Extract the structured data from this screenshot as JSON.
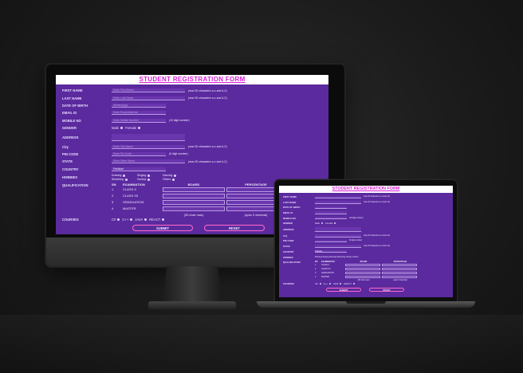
{
  "form": {
    "title": "STUDENT REGISTRATION FORM",
    "fields": [
      {
        "label": "FIRST NAME",
        "placeholder": "Enter First Name",
        "hint": "(max 30 characters a-z and A-Z)"
      },
      {
        "label": "LAST NAME",
        "placeholder": "Enter Last Name",
        "hint": "(max 30 characters a-z and A-Z)"
      },
      {
        "label": "DATE OF BIRTH",
        "placeholder": "dd/mm/yyyy",
        "hint": ""
      },
      {
        "label": "EMAIL ID",
        "placeholder": "Enter Email Address",
        "hint": ""
      },
      {
        "label": "MOBILE NO",
        "placeholder": "Enter Mobile Number",
        "hint": "(10 digit number)"
      }
    ],
    "gender": {
      "label": "GENDER",
      "options": [
        "Male",
        "Female"
      ]
    },
    "address": {
      "label": "ADDRESS"
    },
    "city": {
      "label": "City",
      "placeholder": "Enter City Name",
      "hint": "(max 30 characters a-z and A-Z)"
    },
    "pin": {
      "label": "PIN CODE",
      "placeholder": "Enter Pin Code",
      "hint": "(6 digit number)"
    },
    "state": {
      "label": "STATE",
      "placeholder": "Enter State Name",
      "hint": "(max 30 characters a-z and A-Z)"
    },
    "country": {
      "label": "COUNTRY",
      "value": "Pakistan"
    },
    "hobbies": {
      "label": "HOBBIES",
      "items": [
        "Drawing",
        "Singing",
        "Dancing",
        "Sketching",
        "Hockey",
        "Others"
      ]
    },
    "qualification": {
      "label": "QUALIFICATION",
      "headers": [
        "SN",
        "EXAMINATION",
        "BOARD",
        "PERCENTAGE"
      ],
      "rows": [
        {
          "sn": "1",
          "exam": "CLASS X"
        },
        {
          "sn": "2",
          "exam": "CLASS XII"
        },
        {
          "sn": "3",
          "exam": "GRADUATION"
        },
        {
          "sn": "4",
          "exam": "MASTER"
        }
      ],
      "note_board": "(30 char max)",
      "note_pct": "(upto 2 decimal)"
    },
    "courses": {
      "label": "COURSES",
      "items": [
        "C#",
        "C++",
        "JAVA",
        "REACT"
      ]
    },
    "submit_label": "SUBMIT",
    "reset_label": "RESET"
  }
}
